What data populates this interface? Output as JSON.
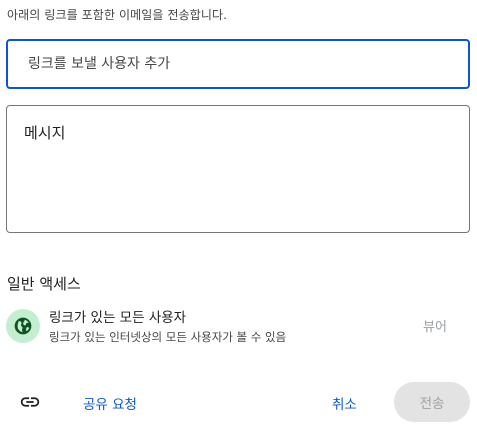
{
  "intro_text": "아래의 링크를 포함한 이메일을 전송합니다.",
  "recipient": {
    "placeholder": "링크를 보낼 사용자 추가"
  },
  "message": {
    "placeholder": "메시지"
  },
  "general_access": {
    "heading": "일반 액세스",
    "title": "링크가 있는 모든 사용자",
    "description": "링크가 있는 인터넷상의 모든 사용자가 볼 수 있음",
    "role": "뷰어",
    "icon": "globe-icon"
  },
  "footer": {
    "link_icon": "link-icon",
    "share_request": "공유 요청",
    "cancel": "취소",
    "send": "전송"
  },
  "colors": {
    "accent": "#0b57d0",
    "globe_bg": "#c4eed0",
    "globe_fg": "#0f5223",
    "disabled_bg": "#e3e3e3"
  }
}
